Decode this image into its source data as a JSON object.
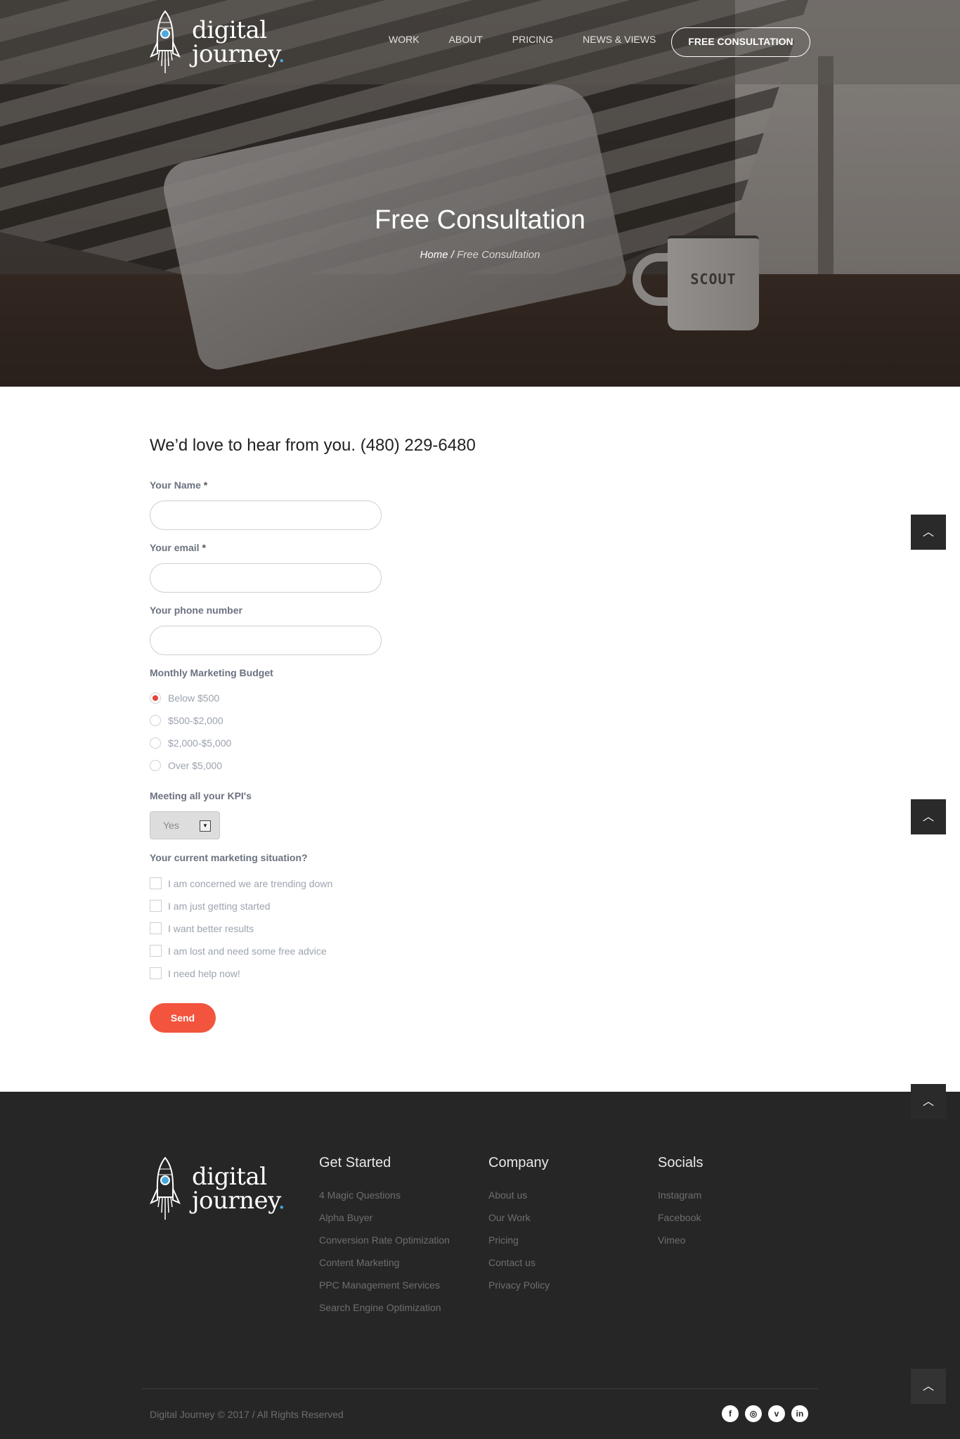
{
  "brand": {
    "logo_line1": "digital",
    "logo_line2": "journey",
    "logo_dot": ".",
    "accent_color": "#4aa8e0",
    "cta_color": "#f2543d"
  },
  "nav": {
    "items": [
      "WORK",
      "ABOUT",
      "PRICING",
      "NEWS & VIEWS"
    ],
    "cta_label": "FREE CONSULTATION"
  },
  "hero": {
    "title": "Free Consultation",
    "breadcrumb_home": "Home",
    "breadcrumb_sep": " / ",
    "breadcrumb_current": "Free Consultation",
    "mug_text": "SCOUT"
  },
  "form": {
    "headline": "We’d love to hear from you. (480) 229-6480",
    "name_label": "Your Name",
    "email_label": "Your email",
    "phone_label": "Your phone number",
    "required_marker": "*",
    "budget_label": "Monthly Marketing Budget",
    "budget_options": [
      "Below $500",
      "$500-$2,000",
      "$2,000-$5,000",
      "Over $5,000"
    ],
    "budget_selected": "Below $500",
    "kpi_label": "Meeting all your KPI's",
    "kpi_value": "Yes",
    "situation_label": "Your current marketing situation?",
    "situation_options": [
      "I am concerned we are trending down",
      "I am just getting started",
      "I want better results",
      "I am lost and need some free advice",
      "I need help now!"
    ],
    "send_label": "Send"
  },
  "back_to_top_icon": "chevron-up-icon",
  "footer": {
    "columns": [
      {
        "heading": "Get Started",
        "links": [
          "4 Magic Questions",
          "Alpha Buyer",
          "Conversion Rate Optimization",
          "Content Marketing",
          "PPC Management Services",
          "Search Engine Optimization"
        ]
      },
      {
        "heading": "Company",
        "links": [
          "About us",
          "Our Work",
          "Pricing",
          "Contact us",
          "Privacy Policy"
        ]
      },
      {
        "heading": "Socials",
        "links": [
          "Instagram",
          "Facebook",
          "Vimeo"
        ]
      }
    ],
    "copyright": "Digital Journey © 2017 / All Rights Reserved",
    "social_icons": [
      "facebook-icon",
      "instagram-icon",
      "vimeo-icon",
      "linkedin-icon"
    ]
  }
}
